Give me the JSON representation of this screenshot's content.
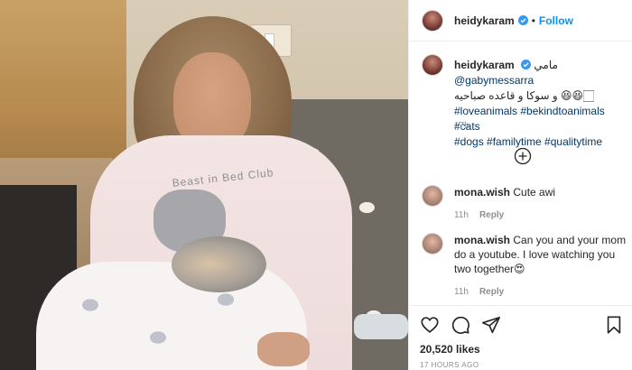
{
  "header": {
    "username": "heidykaram",
    "separator": "•",
    "follow_label": "Follow"
  },
  "caption": {
    "username": "heidykaram",
    "line1_text": "مامي",
    "line1_mention": "@gabymessarra",
    "line2_text": "و سوكا و قاعده صباحيه 😆😆🏻",
    "hashtags_line1": "#loveanimals #bekindtoanimals #cats",
    "hashtags_line2": "#dogs #familytime #qualitytime",
    "time": "17h"
  },
  "comments": [
    {
      "username": "mona.wish",
      "text": "Cute awi",
      "time": "11h",
      "reply_label": "Reply"
    },
    {
      "username": "mona.wish",
      "text": "Can you and your mom do a youtube. I love watching you two together😍",
      "time": "11h",
      "reply_label": "Reply"
    }
  ],
  "post": {
    "likes": "20,520 likes",
    "posted": "17 HOURS AGO",
    "photo_shirt_text": "Beast in Bed Club"
  },
  "icons": {
    "verified": "verified-badge-icon",
    "load_more": "plus-circle-icon",
    "like": "heart-icon",
    "comment": "comment-icon",
    "share": "share-icon",
    "save": "bookmark-icon"
  },
  "colors": {
    "link_blue": "#0095f6",
    "hashtag_blue": "#00376b",
    "muted": "#8e8e8e"
  }
}
